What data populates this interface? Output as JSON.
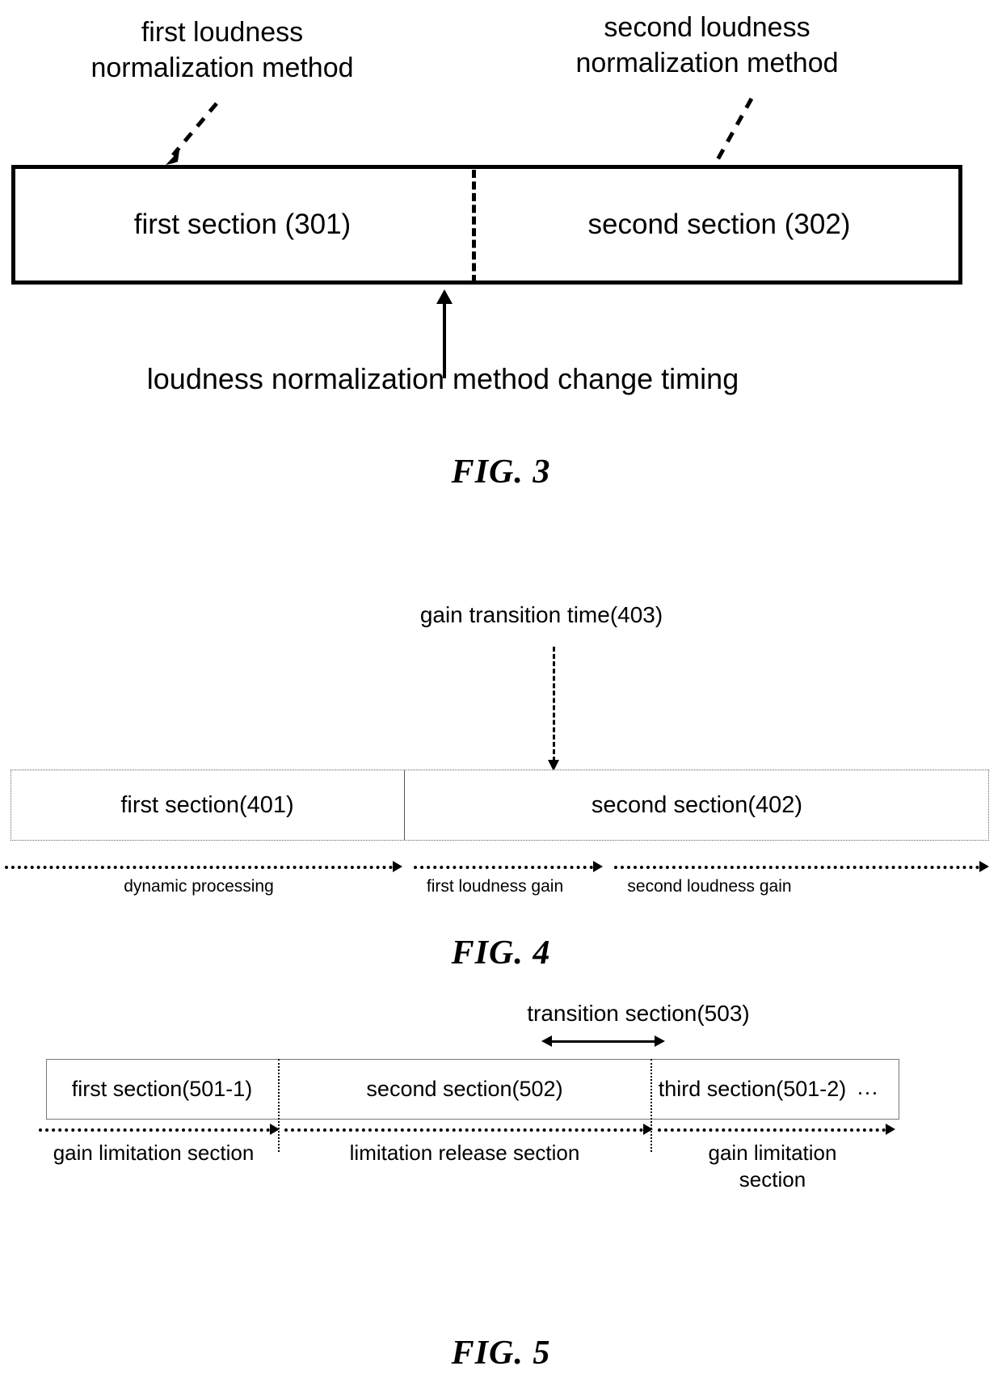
{
  "figures": [
    {
      "id": "fig3",
      "caption": "FIG. 3",
      "callouts": {
        "left": "first loudness\nnormalization method",
        "right": "second loudness\nnormalization method"
      },
      "sections": [
        {
          "label": "first section (301)"
        },
        {
          "label": "second section (302)"
        }
      ],
      "bottom_label": "loudness normalization method change timing"
    },
    {
      "id": "fig4",
      "caption": "FIG. 4",
      "top_label": "gain transition time(403)",
      "sections": [
        {
          "label": "first section(401)"
        },
        {
          "label": "second section(402)"
        }
      ],
      "timeline_labels": [
        "dynamic processing",
        "first loudness gain",
        "second loudness gain"
      ]
    },
    {
      "id": "fig5",
      "caption": "FIG. 5",
      "top_label": "transition section(503)",
      "sections": [
        {
          "label": "first section(501-1)"
        },
        {
          "label": "second section(502)"
        },
        {
          "label": "third section(501-2)"
        }
      ],
      "continuation": "···",
      "timeline_labels": [
        "gain limitation section",
        "limitation release section",
        "gain limitation\nsection"
      ]
    }
  ],
  "colors": {
    "ink": "#000000",
    "background": "#ffffff",
    "thin_rule": "#666666"
  }
}
